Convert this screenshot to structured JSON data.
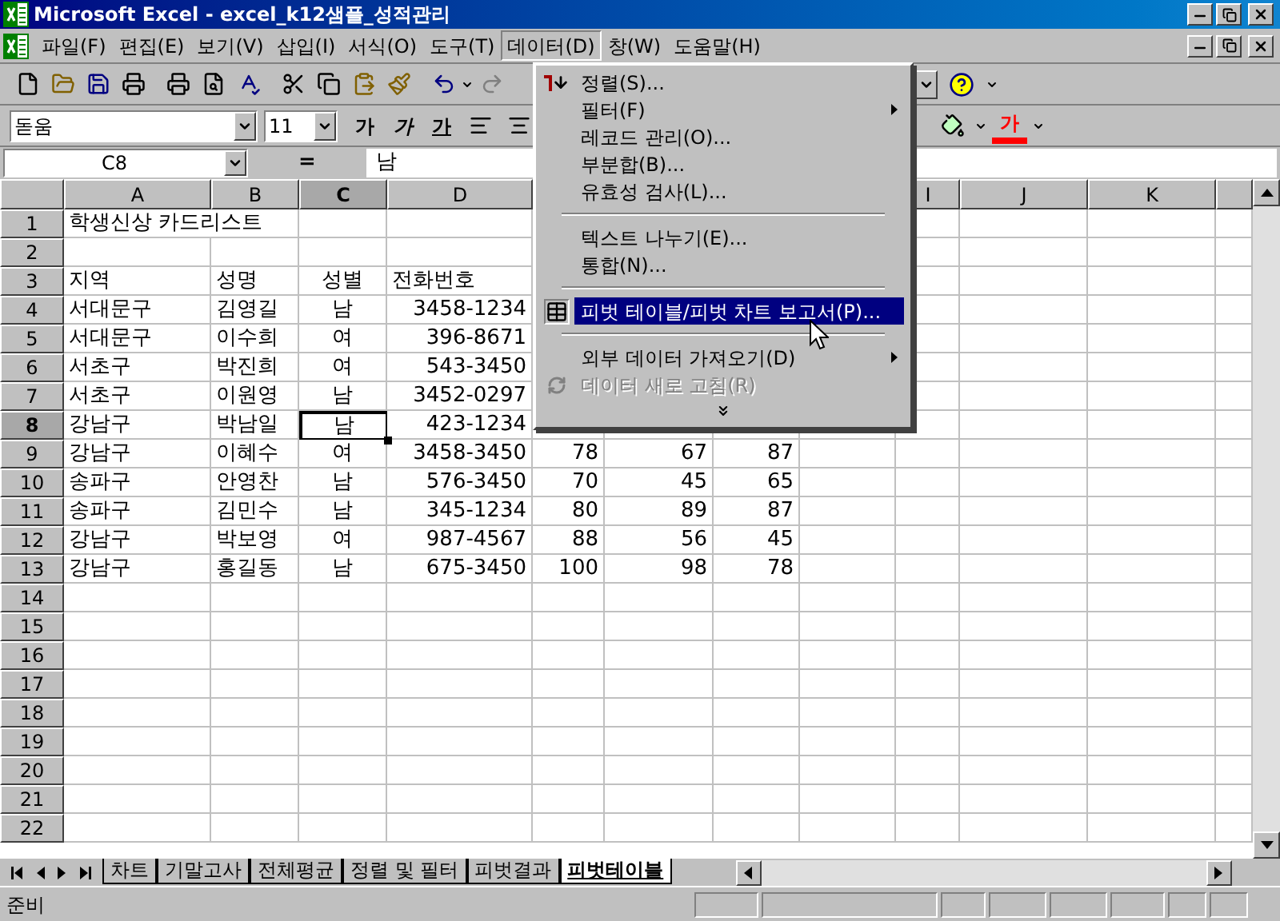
{
  "window": {
    "title": "Microsoft Excel - excel_k12샘플_성적관리"
  },
  "menu_bar": [
    {
      "label": "파일(F)",
      "selected": false
    },
    {
      "label": "편집(E)",
      "selected": false
    },
    {
      "label": "보기(V)",
      "selected": false
    },
    {
      "label": "삽입(I)",
      "selected": false
    },
    {
      "label": "서식(O)",
      "selected": false
    },
    {
      "label": "도구(T)",
      "selected": false
    },
    {
      "label": "데이터(D)",
      "selected": true
    },
    {
      "label": "창(W)",
      "selected": false
    },
    {
      "label": "도움말(H)",
      "selected": false
    }
  ],
  "format_toolbar": {
    "font": "돋움",
    "size": "11",
    "bold": "가",
    "italic": "가",
    "underline": "가",
    "font_color": "가"
  },
  "formula_bar": {
    "name_box": "C8",
    "equals": "=",
    "value": "남"
  },
  "data_menu": [
    {
      "kind": "sort",
      "label": "정렬(S)...",
      "submenu": false,
      "selected": false,
      "disabled": false
    },
    {
      "kind": "item",
      "label": "필터(F)",
      "submenu": true,
      "selected": false,
      "disabled": false
    },
    {
      "kind": "item",
      "label": "레코드 관리(O)...",
      "submenu": false,
      "selected": false,
      "disabled": false
    },
    {
      "kind": "item",
      "label": "부분합(B)...",
      "submenu": false,
      "selected": false,
      "disabled": false
    },
    {
      "kind": "item",
      "label": "유효성 검사(L)...",
      "submenu": false,
      "selected": false,
      "disabled": false
    },
    {
      "kind": "separator"
    },
    {
      "kind": "item",
      "label": "텍스트 나누기(E)...",
      "submenu": false,
      "selected": false,
      "disabled": false
    },
    {
      "kind": "item",
      "label": "통합(N)...",
      "submenu": false,
      "selected": false,
      "disabled": false
    },
    {
      "kind": "separator"
    },
    {
      "kind": "pivot",
      "label": "피벗 테이블/피벗 차트 보고서(P)...",
      "submenu": false,
      "selected": true,
      "disabled": false
    },
    {
      "kind": "separator"
    },
    {
      "kind": "item",
      "label": "외부 데이터 가져오기(D)",
      "submenu": true,
      "selected": false,
      "disabled": false
    },
    {
      "kind": "refresh",
      "label": "데이터 새로 고침(R)",
      "submenu": false,
      "selected": false,
      "disabled": true
    },
    {
      "kind": "more"
    }
  ],
  "sheet": {
    "columns": [
      {
        "label": "A",
        "selected": false
      },
      {
        "label": "B",
        "selected": false
      },
      {
        "label": "C",
        "selected": true
      },
      {
        "label": "D",
        "selected": false
      },
      {},
      {},
      {},
      {},
      {
        "label": "I",
        "selected": false
      },
      {
        "label": "J",
        "selected": false
      },
      {
        "label": "K",
        "selected": false
      },
      {
        "selected": false
      }
    ],
    "rows": [
      {
        "number": "1",
        "kind": "title",
        "selected": false,
        "cells": {
          "A": "학생신상 카드리스트"
        }
      },
      {
        "number": "2",
        "kind": "data",
        "selected": false,
        "cells": {}
      },
      {
        "number": "3",
        "kind": "header",
        "selected": false,
        "cells": {
          "A": "지역",
          "B": "성명",
          "C": "성별",
          "D": "전화번호"
        }
      },
      {
        "number": "4",
        "kind": "data",
        "selected": false,
        "cells": {
          "A": "서대문구",
          "B": "김영길",
          "C": "남",
          "D": "3458-1234"
        }
      },
      {
        "number": "5",
        "kind": "data",
        "selected": false,
        "cells": {
          "A": "서대문구",
          "B": "이수희",
          "C": "여",
          "D": "396-8671"
        }
      },
      {
        "number": "6",
        "kind": "data",
        "selected": false,
        "cells": {
          "A": "서초구",
          "B": "박진희",
          "C": "여",
          "D": "543-3450"
        }
      },
      {
        "number": "7",
        "kind": "data",
        "selected": false,
        "cells": {
          "A": "서초구",
          "B": "이원영",
          "C": "남",
          "D": "3452-0297"
        }
      },
      {
        "number": "8",
        "kind": "data",
        "selected": true,
        "cells": {
          "A": "강남구",
          "B": "박남일",
          "C": "남",
          "D": "423-1234"
        }
      },
      {
        "number": "9",
        "kind": "data",
        "selected": false,
        "cells": {
          "A": "강남구",
          "B": "이혜수",
          "C": "여",
          "D": "3458-3450",
          "E": "78",
          "F": "67",
          "G": "87"
        }
      },
      {
        "number": "10",
        "kind": "data",
        "selected": false,
        "cells": {
          "A": "송파구",
          "B": "안영찬",
          "C": "남",
          "D": "576-3450",
          "E": "70",
          "F": "45",
          "G": "65"
        }
      },
      {
        "number": "11",
        "kind": "data",
        "selected": false,
        "cells": {
          "A": "송파구",
          "B": "김민수",
          "C": "남",
          "D": "345-1234",
          "E": "80",
          "F": "89",
          "G": "87"
        }
      },
      {
        "number": "12",
        "kind": "data",
        "selected": false,
        "cells": {
          "A": "강남구",
          "B": "박보영",
          "C": "여",
          "D": "987-4567",
          "E": "88",
          "F": "56",
          "G": "45"
        }
      },
      {
        "number": "13",
        "kind": "data",
        "selected": false,
        "cells": {
          "A": "강남구",
          "B": "홍길동",
          "C": "남",
          "D": "675-3450",
          "E": "100",
          "F": "98",
          "G": "78"
        }
      },
      {
        "number": "14",
        "kind": "data",
        "selected": false,
        "cells": {}
      },
      {
        "number": "15",
        "kind": "data",
        "selected": false,
        "cells": {}
      },
      {
        "number": "16",
        "kind": "data",
        "selected": false,
        "cells": {}
      },
      {
        "number": "17",
        "kind": "data",
        "selected": false,
        "cells": {}
      },
      {
        "number": "18",
        "kind": "data",
        "selected": false,
        "cells": {}
      },
      {
        "number": "19",
        "kind": "data",
        "selected": false,
        "cells": {}
      },
      {
        "number": "20",
        "kind": "data",
        "selected": false,
        "cells": {}
      },
      {
        "number": "21",
        "kind": "data",
        "selected": false,
        "cells": {}
      },
      {
        "number": "22",
        "kind": "data",
        "selected": false,
        "cells": {}
      }
    ]
  },
  "sheet_tabs": [
    {
      "label": "차트",
      "selected": false
    },
    {
      "label": "기말고사",
      "selected": false
    },
    {
      "label": "전체평균",
      "selected": false
    },
    {
      "label": "정렬 및 필터",
      "selected": false
    },
    {
      "label": "피벗결과",
      "selected": false
    },
    {
      "label": "피벗테이블",
      "selected": true
    }
  ],
  "status_bar": {
    "text": "준비"
  }
}
